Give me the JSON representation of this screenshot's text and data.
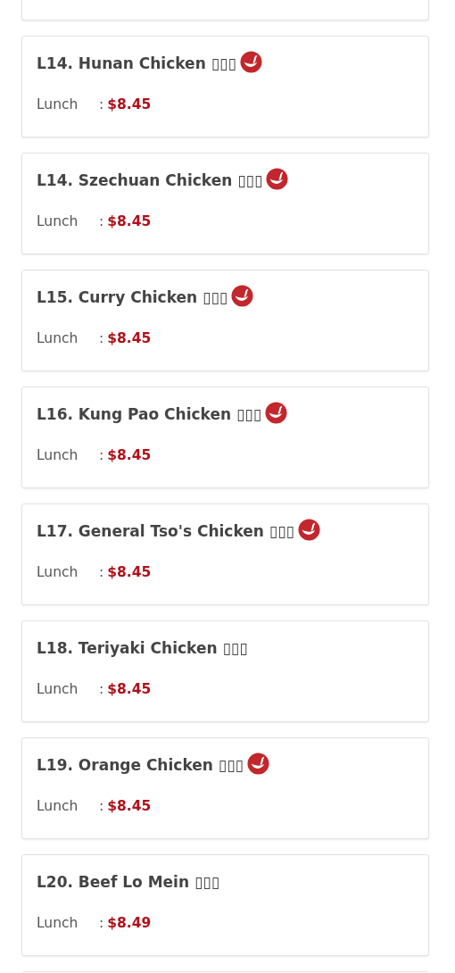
{
  "items": [
    {
      "name": "L14. Hunan Chicken ▯▯▯",
      "spicy": true,
      "prices": [
        {
          "label": "Lunch",
          "separator": ":",
          "price": "$8.45"
        }
      ]
    },
    {
      "name": "L14. Szechuan Chicken ▯▯▯",
      "spicy": true,
      "prices": [
        {
          "label": "Lunch",
          "separator": ":",
          "price": "$8.45"
        }
      ]
    },
    {
      "name": "L15. Curry Chicken ▯▯▯",
      "spicy": true,
      "prices": [
        {
          "label": "Lunch",
          "separator": ":",
          "price": "$8.45"
        }
      ]
    },
    {
      "name": "L16. Kung Pao Chicken ▯▯▯",
      "spicy": true,
      "prices": [
        {
          "label": "Lunch",
          "separator": ":",
          "price": "$8.45"
        }
      ]
    },
    {
      "name": "L17. General Tso's Chicken ▯▯▯",
      "spicy": true,
      "prices": [
        {
          "label": "Lunch",
          "separator": ":",
          "price": "$8.45"
        }
      ]
    },
    {
      "name": "L18. Teriyaki Chicken ▯▯▯",
      "spicy": false,
      "prices": [
        {
          "label": "Lunch",
          "separator": ":",
          "price": "$8.45"
        }
      ]
    },
    {
      "name": "L19. Orange Chicken ▯▯▯",
      "spicy": true,
      "prices": [
        {
          "label": "Lunch",
          "separator": ":",
          "price": "$8.45"
        }
      ]
    },
    {
      "name": "L20. Beef Lo Mein ▯▯▯",
      "spicy": false,
      "prices": [
        {
          "label": "Lunch",
          "separator": ":",
          "price": "$8.49"
        }
      ]
    }
  ]
}
